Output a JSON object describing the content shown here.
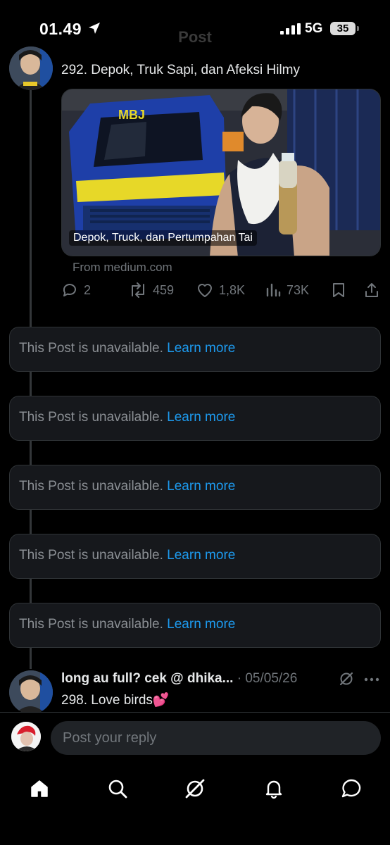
{
  "status_bar": {
    "time": "01.49",
    "network": "5G",
    "battery": "35"
  },
  "header": {
    "title": "Post"
  },
  "post1": {
    "text": "292. Depok, Truk Sapi, dan Afeksi Hilmy",
    "card": {
      "caption": "Depok, Truck, dan Pertumpahan Tai",
      "source": "From medium.com",
      "truck_plate": "MBJ"
    },
    "actions": {
      "replies": "2",
      "reposts": "459",
      "likes": "1,8K",
      "views": "73K"
    }
  },
  "unavailable": [
    {
      "message": "This Post is unavailable.",
      "link": "Learn more"
    },
    {
      "message": "This Post is unavailable.",
      "link": "Learn more"
    },
    {
      "message": "This Post is unavailable.",
      "link": "Learn more"
    },
    {
      "message": "This Post is unavailable.",
      "link": "Learn more"
    },
    {
      "message": "This Post is unavailable.",
      "link": "Learn more"
    }
  ],
  "post2": {
    "author": "long au full? cek @ dhika...",
    "separator": " · ",
    "date": "05/05/26",
    "text": "298. Love birds💕"
  },
  "reply": {
    "placeholder": "Post your reply"
  },
  "tabbar": {
    "icons": [
      "home-icon",
      "search-icon",
      "grok-icon",
      "notifications-icon",
      "messages-icon"
    ]
  },
  "colors": {
    "accent": "#1d9bf0",
    "muted": "#71767b",
    "card_bg": "#16181c"
  }
}
